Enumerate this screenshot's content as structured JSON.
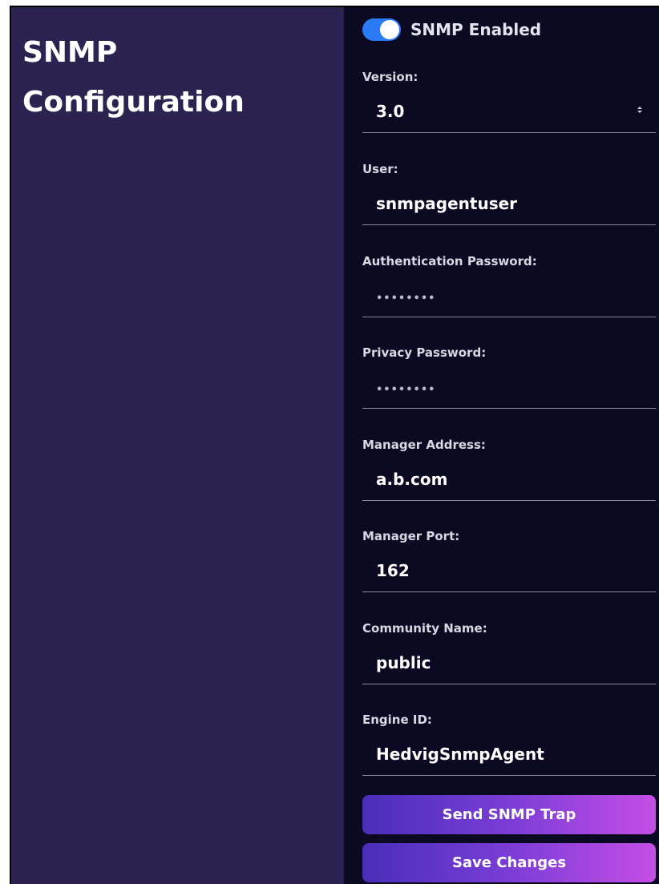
{
  "page": {
    "title": "SNMP Configuration"
  },
  "toggle": {
    "label": "SNMP Enabled",
    "enabled": true,
    "color": "#2a7bf5"
  },
  "fields": {
    "version": {
      "label": "Version:",
      "value": "3.0"
    },
    "user": {
      "label": "User:",
      "value": "snmpagentuser"
    },
    "auth_password": {
      "label": "Authentication Password:",
      "value": "••••••••"
    },
    "privacy_password": {
      "label": "Privacy Password:",
      "value": "••••••••"
    },
    "manager_address": {
      "label": "Manager Address:",
      "value": "a.b.com"
    },
    "manager_port": {
      "label": "Manager Port:",
      "value": "162"
    },
    "community_name": {
      "label": "Community Name:",
      "value": "public"
    },
    "engine_id": {
      "label": "Engine ID:",
      "value": "HedvigSnmpAgent"
    }
  },
  "buttons": {
    "send_trap": "Send SNMP Trap",
    "save": "Save Changes"
  },
  "colors": {
    "left_panel_bg": "#2d2350",
    "right_panel_bg": "#0c0a22",
    "button_gradient_start": "#4a2eb8",
    "button_gradient_end": "#c54ee6"
  }
}
